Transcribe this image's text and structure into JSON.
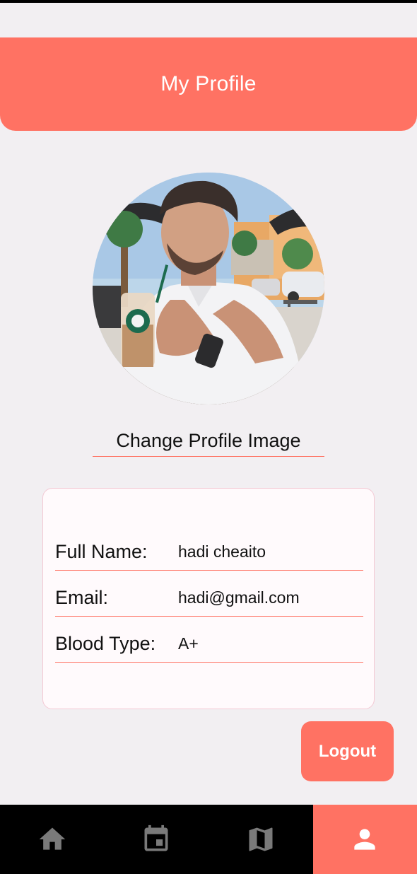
{
  "header": {
    "title": "My Profile"
  },
  "avatar": {
    "icon": "profile-photo"
  },
  "change_image_label": "Change Profile Image",
  "profile": {
    "fields": [
      {
        "label": "Full Name:",
        "value": "hadi cheaito"
      },
      {
        "label": "Email:",
        "value": "hadi@gmail.com"
      },
      {
        "label": "Blood Type:",
        "value": "A+"
      }
    ]
  },
  "logout_label": "Logout",
  "nav": {
    "active": "profile",
    "items": [
      {
        "icon": "home-icon"
      },
      {
        "icon": "calendar-icon"
      },
      {
        "icon": "map-icon"
      },
      {
        "icon": "person-icon"
      }
    ]
  },
  "colors": {
    "accent": "#ff7263",
    "background": "#f2eff2",
    "nav": "#000000"
  }
}
